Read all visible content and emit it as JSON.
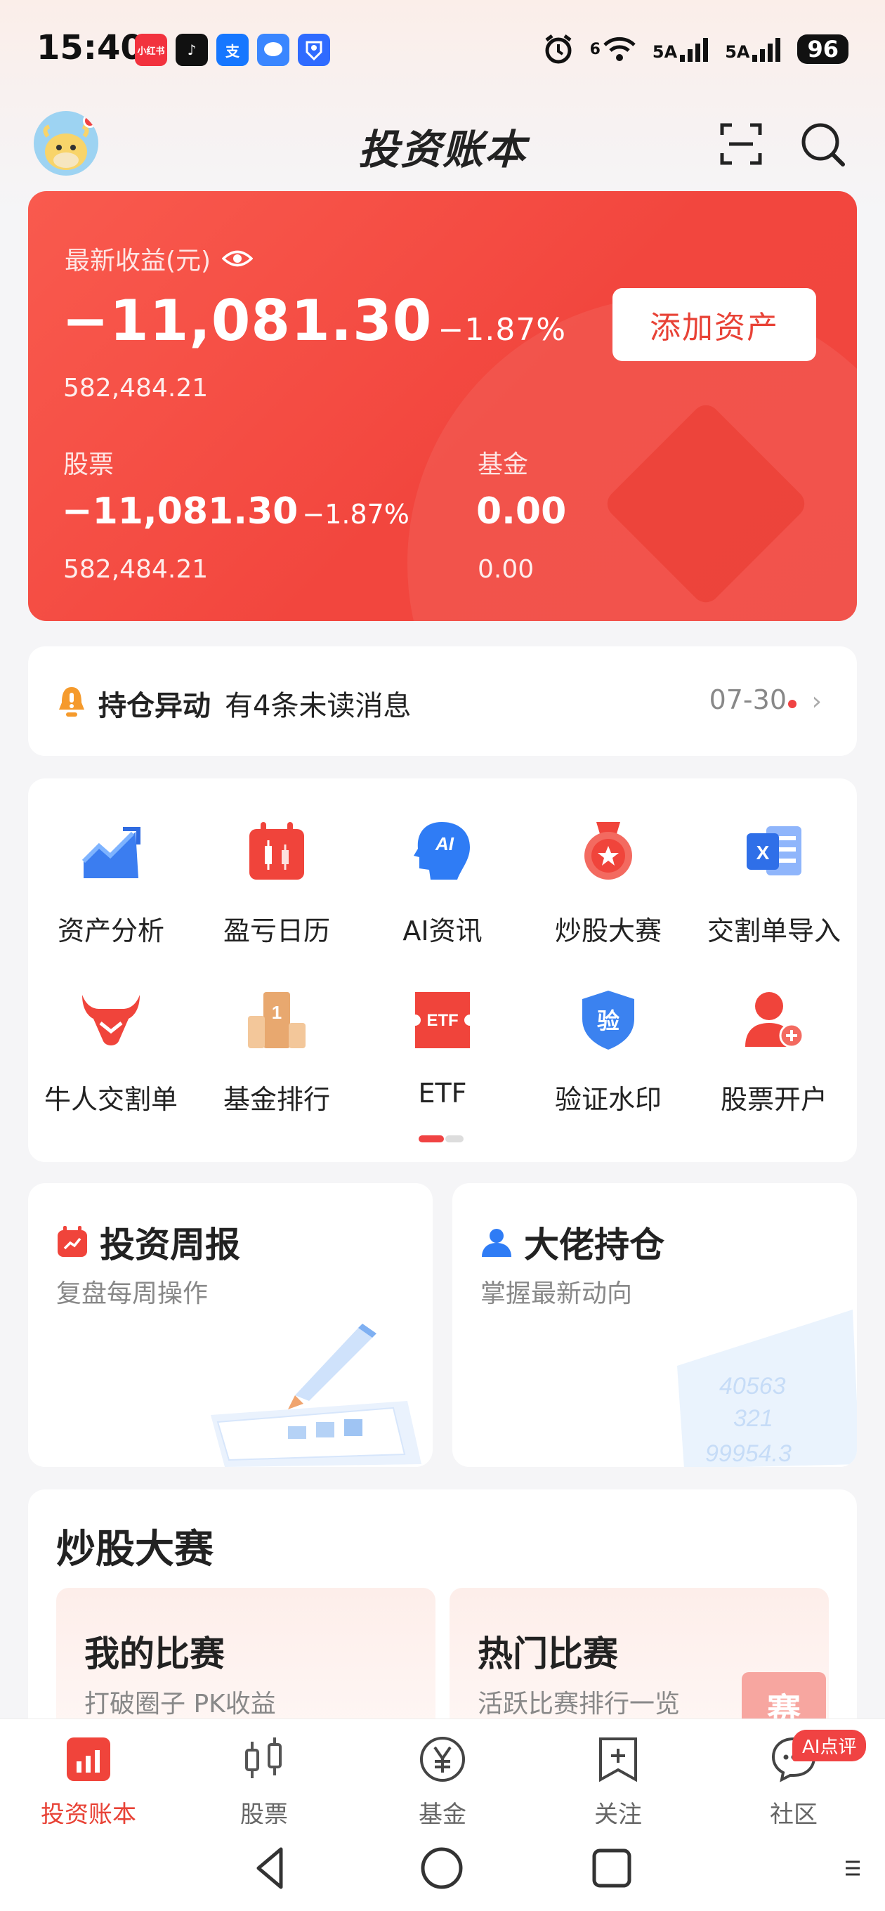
{
  "status_bar": {
    "time": "15:40",
    "apps": [
      {
        "icon": "xiaohongshu-icon",
        "label": "小红书",
        "color": "#f2323e"
      },
      {
        "icon": "douyin-icon",
        "label": "♪",
        "color": "#111111"
      },
      {
        "icon": "alipay-icon",
        "label": "支",
        "color": "#1677ff"
      },
      {
        "icon": "message-icon",
        "label": "",
        "color": "#3a86ff"
      },
      {
        "icon": "account-icon",
        "label": "",
        "color": "#2f6bff"
      }
    ],
    "signal_1": "5A",
    "signal_2": "5A",
    "wifi_label": "6",
    "battery": "96"
  },
  "header": {
    "title": "投资账本"
  },
  "summary": {
    "latest_label": "最新收益(元)",
    "latest_value": "−11,081.30",
    "latest_pct": "−1.87%",
    "latest_total": "582,484.21",
    "add_button": "添加资产",
    "stock_label": "股票",
    "stock_value": "−11,081.30",
    "stock_pct": "−1.87%",
    "stock_total": "582,484.21",
    "fund_label": "基金",
    "fund_value": "0.00",
    "fund_total": "0.00"
  },
  "notice": {
    "title": "持仓异动",
    "message": "有4条未读消息",
    "date": "07-30"
  },
  "grid": [
    {
      "label": "资产分析",
      "icon": "trend-chart-icon"
    },
    {
      "label": "盈亏日历",
      "icon": "calendar-candle-icon"
    },
    {
      "label": "AI资讯",
      "icon": "ai-head-icon"
    },
    {
      "label": "炒股大赛",
      "icon": "medal-icon"
    },
    {
      "label": "交割单导入",
      "icon": "excel-import-icon"
    },
    {
      "label": "牛人交割单",
      "icon": "bull-icon"
    },
    {
      "label": "基金排行",
      "icon": "podium-icon"
    },
    {
      "label": "ETF",
      "icon": "etf-ticket-icon"
    },
    {
      "label": "验证水印",
      "icon": "shield-verify-icon"
    },
    {
      "label": "股票开户",
      "icon": "user-add-icon"
    }
  ],
  "grid_extras": {
    "podium_number": "1",
    "ai_text": "AI",
    "etf_text": "ETF",
    "verify_text": "验",
    "excel_text": "X"
  },
  "cards": {
    "weekly_title": "投资周报",
    "weekly_sub": "复盘每周操作",
    "holdings_title": "大佬持仓",
    "holdings_sub": "掌握最新动向",
    "deco_numbers": [
      "40563",
      "321",
      "99954.3"
    ]
  },
  "contest": {
    "title": "炒股大赛",
    "mine_title": "我的比赛",
    "mine_sub": "打破圈子 PK收益",
    "hot_title": "热门比赛",
    "hot_sub": "活跃比赛排行一览",
    "hot_badge": "赛"
  },
  "tabs": [
    {
      "label": "投资账本",
      "icon": "ledger-icon"
    },
    {
      "label": "股票",
      "icon": "candlestick-icon"
    },
    {
      "label": "基金",
      "icon": "yen-circle-icon"
    },
    {
      "label": "关注",
      "icon": "bookmark-plus-icon"
    },
    {
      "label": "社区",
      "icon": "chat-bubble-icon"
    }
  ],
  "ai_badge": "AI点评",
  "colors": {
    "accent": "#f04343",
    "card_red": "#f2463e"
  }
}
